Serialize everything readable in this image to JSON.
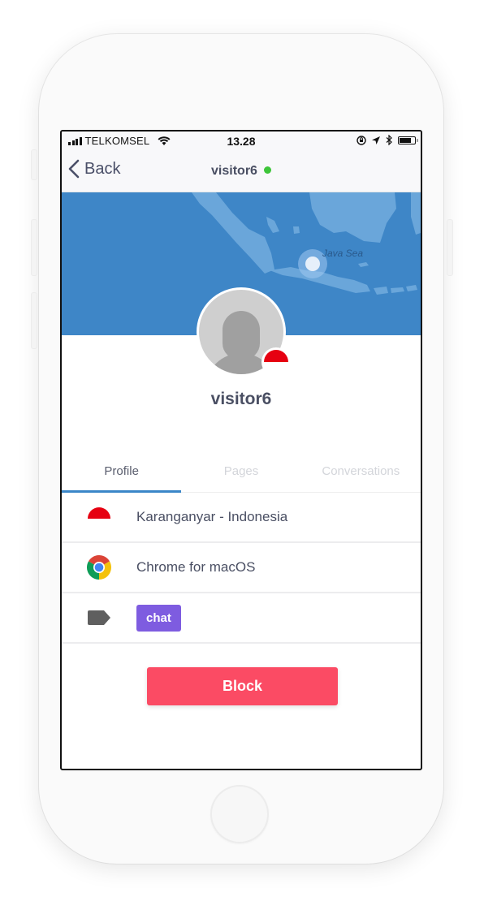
{
  "status_bar": {
    "carrier": "TELKOMSEL",
    "time": "13.28",
    "icons": [
      "signal-icon",
      "wifi-icon",
      "orientation-lock-icon",
      "location-icon",
      "bluetooth-icon",
      "battery-icon"
    ]
  },
  "nav": {
    "back_label": "Back",
    "title": "visitor6",
    "online_color": "#3ec53a"
  },
  "map": {
    "label": "Java Sea",
    "water_color": "#3e86c7",
    "land_color": "#6aa6da"
  },
  "profile": {
    "username": "visitor6",
    "country_flag": "Indonesia"
  },
  "tabs": [
    {
      "label": "Profile",
      "active": true
    },
    {
      "label": "Pages",
      "active": false
    },
    {
      "label": "Conversations",
      "active": false
    }
  ],
  "details": {
    "location": "Karanganyar - Indonesia",
    "browser": "Chrome for macOS",
    "tag": "chat",
    "tag_color": "#7e5ce0"
  },
  "actions": {
    "block_label": "Block",
    "block_color": "#fb4b64"
  }
}
